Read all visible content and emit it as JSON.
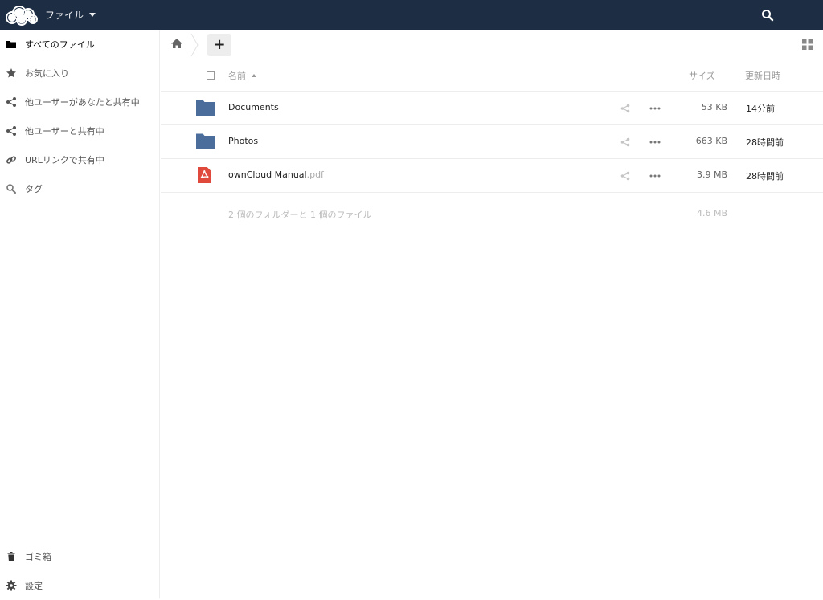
{
  "header": {
    "app_name": "ファイル",
    "logo_icon": "owncloud-logo-icon",
    "search_icon": "search-icon",
    "bg_color": "#1d2d44"
  },
  "sidebar": {
    "items": [
      {
        "label": "すべてのファイル",
        "icon": "folder-icon",
        "active": true
      },
      {
        "label": "お気に入り",
        "icon": "star-icon"
      },
      {
        "label": "他ユーザーがあなたと共有中",
        "icon": "share-icon"
      },
      {
        "label": "他ユーザーと共有中",
        "icon": "share-icon"
      },
      {
        "label": "URLリンクで共有中",
        "icon": "link-icon"
      },
      {
        "label": "タグ",
        "icon": "tag-search-icon"
      }
    ],
    "bottom": [
      {
        "label": "ゴミ箱",
        "icon": "trash-icon"
      },
      {
        "label": "設定",
        "icon": "gear-icon"
      }
    ]
  },
  "controls": {
    "new_label": "+",
    "home_icon": "home-icon",
    "view_toggle_icon": "grid-view-icon"
  },
  "table": {
    "columns": {
      "name": "名前",
      "size": "サイズ",
      "modified": "更新日時"
    },
    "rows": [
      {
        "name": "Documents",
        "ext": "",
        "type": "folder",
        "size": "53 KB",
        "modified": "14分前"
      },
      {
        "name": "Photos",
        "ext": "",
        "type": "folder",
        "size": "663 KB",
        "modified": "28時間前"
      },
      {
        "name": "ownCloud Manual",
        "ext": ".pdf",
        "type": "pdf",
        "size": "3.9 MB",
        "modified": "28時間前"
      }
    ],
    "summary": {
      "text": "2 個のフォルダーと 1 個のファイル",
      "size": "4.6 MB"
    }
  },
  "colors": {
    "folder": "#4a6d9c",
    "pdf": "#e04a3c",
    "accent": "#1d2d44"
  }
}
